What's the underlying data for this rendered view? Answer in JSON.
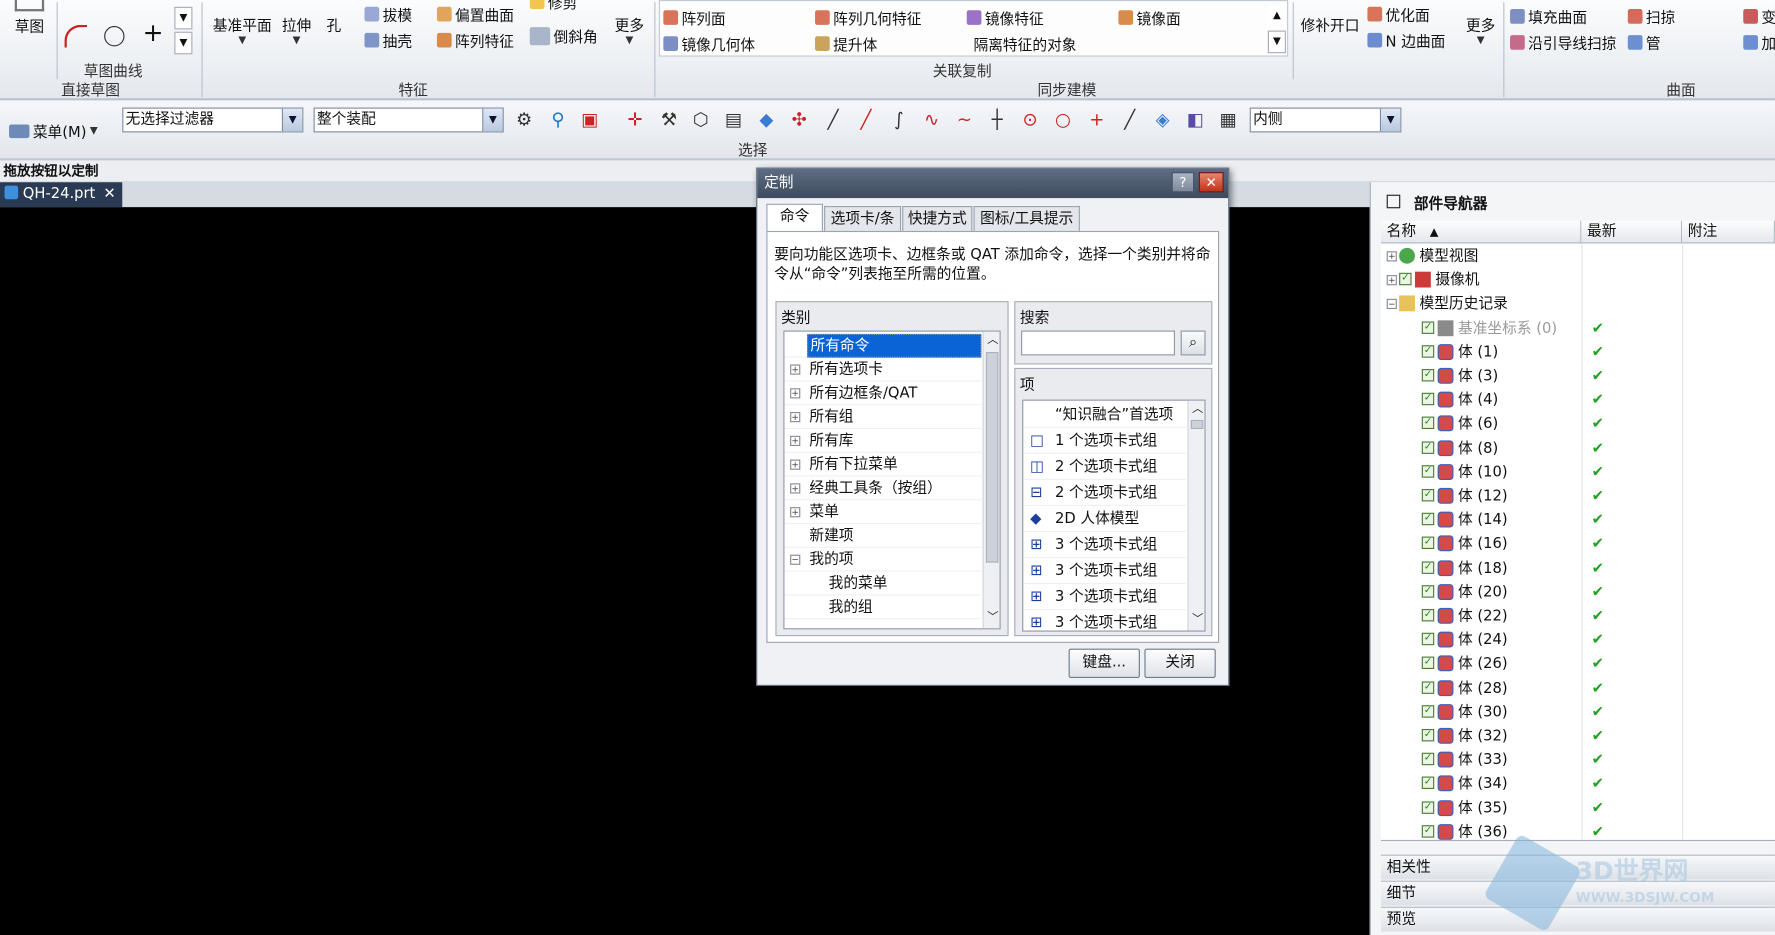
{
  "ribbon": {
    "groups": {
      "direct_sketch": "直接草图",
      "sketch_curve": "草图曲线",
      "feature": "特征",
      "associative_copy": "关联复制",
      "sync_modeling": "同步建模",
      "surface": "曲面"
    },
    "buttons": {
      "sketch": "草图",
      "datum_plane": "基准平面",
      "extrude": "拉伸",
      "hole": "孔",
      "draft": "拔模",
      "shell": "抽壳",
      "offset_surface": "偏置曲面",
      "pattern_feature": "阵列特征",
      "chamfer": "倒斜角",
      "trim": "修剪",
      "more1": "更多",
      "pattern_face": "阵列面",
      "pattern_geometry": "阵列几何特征",
      "mirror_feature": "镜像特征",
      "mirror_face": "镜像面",
      "mirror_geometry": "镜像几何体",
      "promote": "提升体",
      "isolate": "隔离特征的对象",
      "patch_opening": "修补开口",
      "optimize_face": "优化面",
      "n_sided": "N 边曲面",
      "more2": "更多",
      "fill_surface": "填充曲面",
      "sweep": "扫掠",
      "sweep_guide": "沿引导线扫掠",
      "tube": "管",
      "change": "变",
      "add": "加"
    }
  },
  "selection_bar": {
    "menu": "菜单(M)",
    "type_filter": "无选择过滤器",
    "scope": "整个装配",
    "inner": "内侧",
    "label": "选择"
  },
  "hint": "拖放按钮以定制",
  "file_tab": "QH-24.prt",
  "dialog": {
    "title": "定制",
    "help": "?",
    "tabs": [
      "命令",
      "选项卡/条",
      "快捷方式",
      "图标/工具提示"
    ],
    "description": "要向功能区选项卡、边框条或 QAT 添加命令，选择一个类别并将命令从“命令”列表拖至所需的位置。",
    "category_label": "类别",
    "search_label": "搜索",
    "search_value": "",
    "items_label": "项",
    "categories": [
      "所有命令",
      "所有选项卡",
      "所有边框条/QAT",
      "所有组",
      "所有库",
      "所有下拉菜单",
      "经典工具条（按组）",
      "菜单",
      "新建项",
      "我的项",
      "我的菜单",
      "我的组"
    ],
    "items": [
      "“知识融合”首选项",
      "1 个选项卡式组",
      "2 个选项卡式组",
      "2 个选项卡式组",
      "2D 人体模型",
      "3 个选项卡式组",
      "3 个选项卡式组",
      "3 个选项卡式组",
      "3 个选项卡式组"
    ],
    "keyboard_button": "键盘...",
    "close_button": "关闭"
  },
  "navigator": {
    "title": "部件导航器",
    "columns": [
      "名称",
      "最新",
      "附注"
    ],
    "tree": [
      {
        "label": "模型视图",
        "latest": ""
      },
      {
        "label": "摄像机",
        "latest": ""
      },
      {
        "label": "模型历史记录",
        "latest": ""
      },
      {
        "label": "基准坐标系 (0)",
        "latest": "✔"
      },
      {
        "label": "体 (1)",
        "latest": "✔"
      },
      {
        "label": "体 (3)",
        "latest": "✔"
      },
      {
        "label": "体 (4)",
        "latest": "✔"
      },
      {
        "label": "体 (6)",
        "latest": "✔"
      },
      {
        "label": "体 (8)",
        "latest": "✔"
      },
      {
        "label": "体 (10)",
        "latest": "✔"
      },
      {
        "label": "体 (12)",
        "latest": "✔"
      },
      {
        "label": "体 (14)",
        "latest": "✔"
      },
      {
        "label": "体 (16)",
        "latest": "✔"
      },
      {
        "label": "体 (18)",
        "latest": "✔"
      },
      {
        "label": "体 (20)",
        "latest": "✔"
      },
      {
        "label": "体 (22)",
        "latest": "✔"
      },
      {
        "label": "体 (24)",
        "latest": "✔"
      },
      {
        "label": "体 (26)",
        "latest": "✔"
      },
      {
        "label": "体 (28)",
        "latest": "✔"
      },
      {
        "label": "体 (30)",
        "latest": "✔"
      },
      {
        "label": "体 (32)",
        "latest": "✔"
      },
      {
        "label": "体 (33)",
        "latest": "✔"
      },
      {
        "label": "体 (34)",
        "latest": "✔"
      },
      {
        "label": "体 (35)",
        "latest": "✔"
      },
      {
        "label": "体 (36)",
        "latest": "✔"
      }
    ],
    "sections": [
      "相关性",
      "细节",
      "预览"
    ]
  },
  "watermark": {
    "brand": "3D世界网",
    "url": "WWW.3DSJW.COM"
  },
  "colors": {
    "viewport": "#000000",
    "selection": "#0b64d6",
    "check": "#1fa31f"
  }
}
